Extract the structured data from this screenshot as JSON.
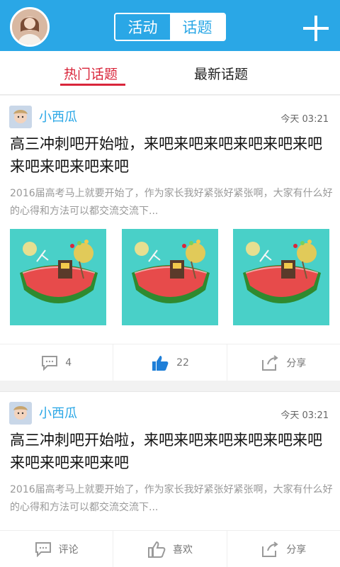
{
  "header": {
    "segments": [
      {
        "label": "活动"
      },
      {
        "label": "话题"
      }
    ],
    "active_segment": "话题"
  },
  "tabs": [
    {
      "label": "热门话题"
    },
    {
      "label": "最新话题"
    }
  ],
  "posts": [
    {
      "user": "小西瓜",
      "time": "今天  03:21",
      "title": "高三冲刺吧开始啦，来吧来吧来吧来吧来吧来吧来吧来吧来吧来吧",
      "excerpt": "2016届高考马上就要开始了，作为家长我好紧张好紧张啊，大家有什么好的心得和方法可以都交流交流下...",
      "images": [
        "watermelon-island-image",
        "watermelon-island-image",
        "watermelon-island-image"
      ],
      "actions": {
        "comment": "4",
        "like": "22",
        "share": "分享"
      },
      "like_active": true
    },
    {
      "user": "小西瓜",
      "time": "今天  03:21",
      "title": "高三冲刺吧开始啦，来吧来吧来吧来吧来吧来吧来吧来吧来吧来吧",
      "excerpt": "2016届高考马上就要开始了，作为家长我好紧张好紧张啊，大家有什么好的心得和方法可以都交流交流下...",
      "actions": {
        "comment": "评论",
        "like": "喜欢",
        "share": "分享"
      },
      "like_active": false
    }
  ],
  "colors": {
    "brand_blue": "#2aa7e6",
    "accent_red": "#d9263b",
    "like_blue": "#1f7fd8"
  }
}
